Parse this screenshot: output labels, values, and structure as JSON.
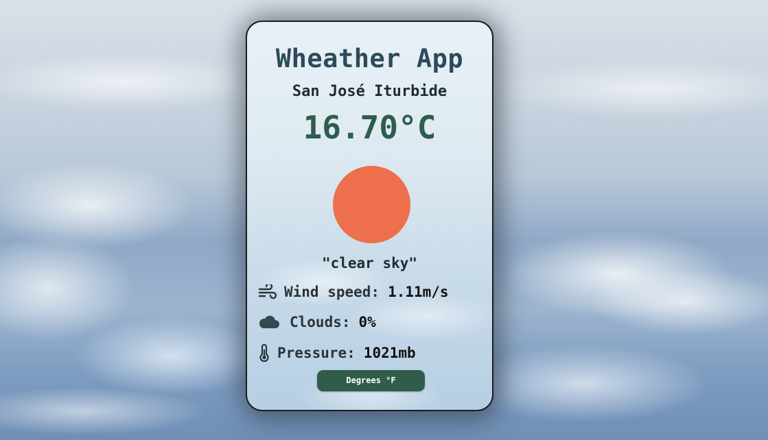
{
  "app": {
    "title": "Wheather App",
    "city": "San José Iturbide",
    "temperature": "16.70°C",
    "description": "\"clear sky\""
  },
  "weather_icon": {
    "name": "sun-icon",
    "color": "#ee6f4b"
  },
  "details": {
    "wind": {
      "icon": "wind-icon",
      "label": "Wind speed:",
      "value": "1.11m/s"
    },
    "clouds": {
      "icon": "cloud-icon",
      "label": "Clouds:",
      "value": "0%"
    },
    "pressure": {
      "icon": "thermometer-icon",
      "label": "Pressure:",
      "value": "1021mb"
    }
  },
  "toggle_button": {
    "label": "Degrees °F"
  },
  "colors": {
    "accent": "#2f5c4b",
    "title": "#2d4a5a",
    "sun": "#ee6f4b"
  }
}
